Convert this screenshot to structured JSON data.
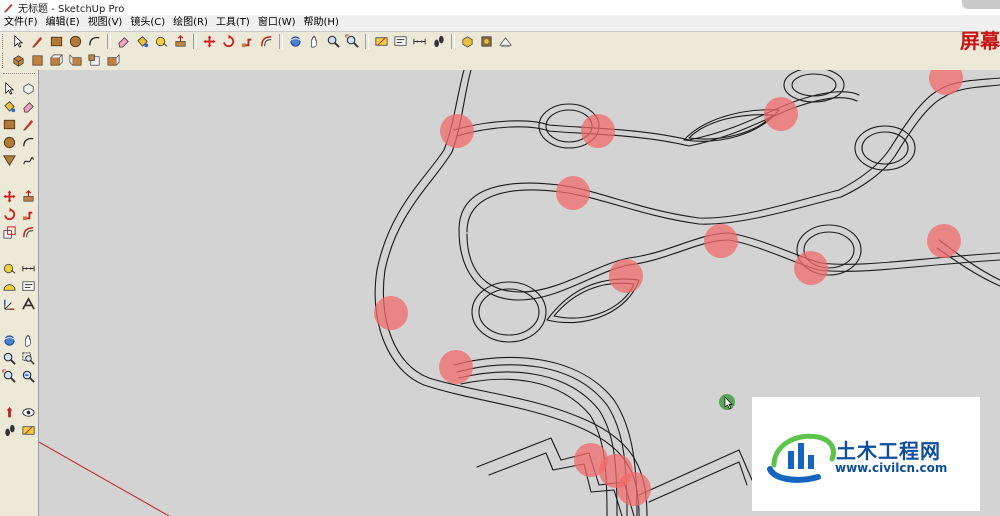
{
  "window": {
    "title": "无标题 - SketchUp Pro"
  },
  "menu": [
    "文件(F)",
    "编辑(E)",
    "视图(V)",
    "镜头(C)",
    "绘图(R)",
    "工具(T)",
    "窗口(W)",
    "帮助(H)"
  ],
  "overlay": {
    "red_text": "屏幕"
  },
  "logo": {
    "title": "土木工程网",
    "url": "www.civilcn.com"
  },
  "colors": {
    "highlight": "#f06b6b",
    "edge": "#1a1a1a",
    "viewport": "#d3d3d3",
    "brand": "#0d4f9c"
  },
  "toolbar_row1": [
    "select-icon",
    "pencil-icon",
    "rectangle-icon",
    "circle-icon",
    "arc-icon",
    "sep",
    "eraser-icon",
    "paint-bucket-icon",
    "tape-measure-icon",
    "push-pull-icon",
    "sep",
    "move-icon",
    "rotate-icon",
    "follow-me-icon",
    "offset-icon",
    "sep",
    "orbit-icon",
    "pan-icon",
    "zoom-icon",
    "zoom-extents-icon",
    "sep",
    "section-icon",
    "text-icon",
    "dimension-icon",
    "walk-icon",
    "sep",
    "component-icon",
    "material-icon",
    "shadow-icon"
  ],
  "toolbar_row2": [
    "iso-view-icon",
    "top-view-icon",
    "front-view-icon",
    "right-view-icon",
    "back-view-icon",
    "left-view-icon"
  ],
  "left_tools": [
    "select-icon",
    "make-component-icon",
    "paint-bucket-icon",
    "eraser-icon",
    "rectangle-icon",
    "line-icon",
    "circle-icon",
    "arc-icon",
    "polygon-icon",
    "freehand-icon",
    "gap",
    "move-icon",
    "push-pull-icon",
    "rotate-icon",
    "follow-me-icon",
    "scale-icon",
    "offset-icon",
    "gap",
    "tape-measure-icon",
    "dimension-icon",
    "protractor-icon",
    "text-icon",
    "axes-icon",
    "3d-text-icon",
    "gap",
    "orbit-icon",
    "pan-icon",
    "zoom-icon",
    "zoom-window-icon",
    "zoom-extents-icon",
    "previous-view-icon",
    "gap",
    "position-camera-icon",
    "look-around-icon",
    "walk-icon",
    "section-plane-icon"
  ]
}
